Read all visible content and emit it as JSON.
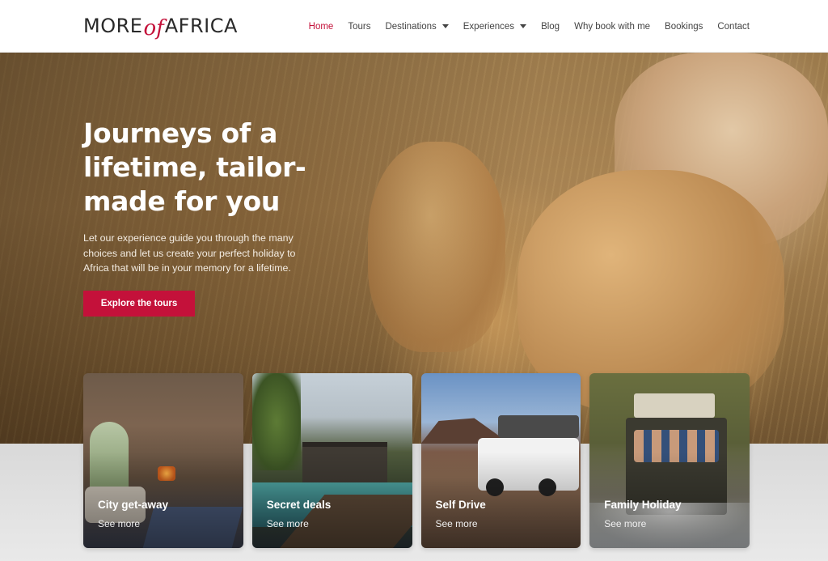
{
  "logo": {
    "part1": "MORE",
    "part2": "of",
    "part3": "AFRICA"
  },
  "nav": {
    "items": [
      {
        "label": "Home",
        "active": true,
        "dropdown": false
      },
      {
        "label": "Tours",
        "active": false,
        "dropdown": false
      },
      {
        "label": "Destinations",
        "active": false,
        "dropdown": true
      },
      {
        "label": "Experiences",
        "active": false,
        "dropdown": true
      },
      {
        "label": "Blog",
        "active": false,
        "dropdown": false
      },
      {
        "label": "Why book with me",
        "active": false,
        "dropdown": false
      },
      {
        "label": "Bookings",
        "active": false,
        "dropdown": false
      },
      {
        "label": "Contact",
        "active": false,
        "dropdown": false
      }
    ]
  },
  "hero": {
    "title": "Journeys of a lifetime, tailor-made for you",
    "subtitle": "Let our experience guide you through the many choices and let us create your perfect holiday to Africa that will be in your memory for a lifetime.",
    "button_label": "Explore the tours"
  },
  "cards": [
    {
      "title": "City get-away",
      "link": "See more"
    },
    {
      "title": "Secret deals",
      "link": "See more"
    },
    {
      "title": "Self Drive",
      "link": "See more"
    },
    {
      "title": "Family Holiday",
      "link": "See more"
    }
  ],
  "colors": {
    "accent": "#c4113a",
    "text": "#444444",
    "white": "#ffffff"
  },
  "icons": {
    "dropdown": "chevron-down-icon"
  }
}
